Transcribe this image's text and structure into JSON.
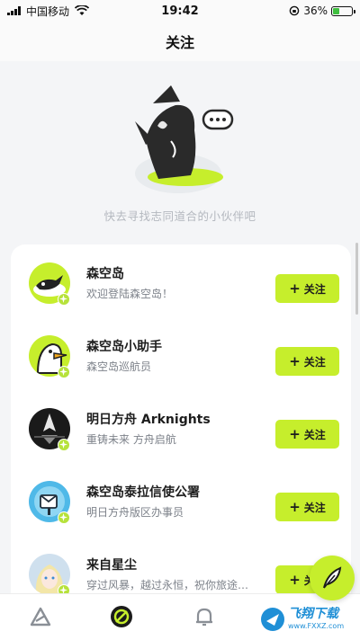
{
  "status_bar": {
    "carrier": "中国移动",
    "time": "19:42",
    "battery_percent": "36%",
    "battery_level": 0.36
  },
  "header": {
    "title": "关注"
  },
  "hero": {
    "text": "快去寻找志同道合的小伙伴吧"
  },
  "follow_label": "关注",
  "accounts": [
    {
      "name": "森空岛",
      "desc": "欢迎登陆森空岛！",
      "button": "关注"
    },
    {
      "name": "森空岛小助手",
      "desc": "森空岛巡航员",
      "button": "关注"
    },
    {
      "name": "明日方舟 Arknights",
      "desc": "重铸未来 方舟启航",
      "button": "关注"
    },
    {
      "name": "森空岛泰拉信使公署",
      "desc": "明日方舟版区办事员",
      "button": "关注"
    },
    {
      "name": "来自星尘",
      "desc": "穿过风暴，越过永恒，祝你旅途…",
      "button": "关注"
    }
  ],
  "watermark": {
    "title": "飞翔下载",
    "url": "www.FXXZ.com"
  },
  "colors": {
    "accent": "#c6ee2c",
    "background": "#f4f5f7",
    "card": "#ffffff"
  },
  "icons": {
    "nav": [
      "home-icon",
      "discover-icon",
      "bell-icon"
    ],
    "fab": "feather-icon"
  }
}
